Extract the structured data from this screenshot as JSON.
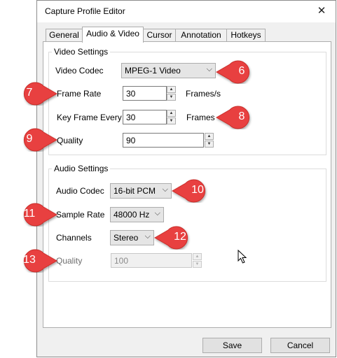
{
  "window": {
    "title": "Capture Profile Editor"
  },
  "tabs": [
    {
      "label": "General"
    },
    {
      "label": "Audio & Video"
    },
    {
      "label": "Cursor"
    },
    {
      "label": "Annotation"
    },
    {
      "label": "Hotkeys"
    }
  ],
  "video": {
    "group_label": "Video Settings",
    "codec_label": "Video Codec",
    "codec_value": "MPEG-1 Video",
    "frame_rate_label": "Frame Rate",
    "frame_rate_value": "30",
    "frame_rate_unit": "Frames/s",
    "key_frame_label": "Key Frame Every",
    "key_frame_value": "30",
    "key_frame_unit": "Frames",
    "quality_label": "Quality",
    "quality_value": "90"
  },
  "audio": {
    "group_label": "Audio Settings",
    "codec_label": "Audio Codec",
    "codec_value": "16-bit PCM",
    "sample_rate_label": "Sample Rate",
    "sample_rate_value": "48000 Hz",
    "channels_label": "Channels",
    "channels_value": "Stereo",
    "quality_label": "Quality",
    "quality_value": "100"
  },
  "callouts": [
    "6",
    "7",
    "8",
    "9",
    "10",
    "11",
    "12",
    "13"
  ],
  "buttons": {
    "save": "Save",
    "cancel": "Cancel"
  },
  "colors": {
    "callout": "#e8413f",
    "callout_border": "#c92e2c"
  }
}
